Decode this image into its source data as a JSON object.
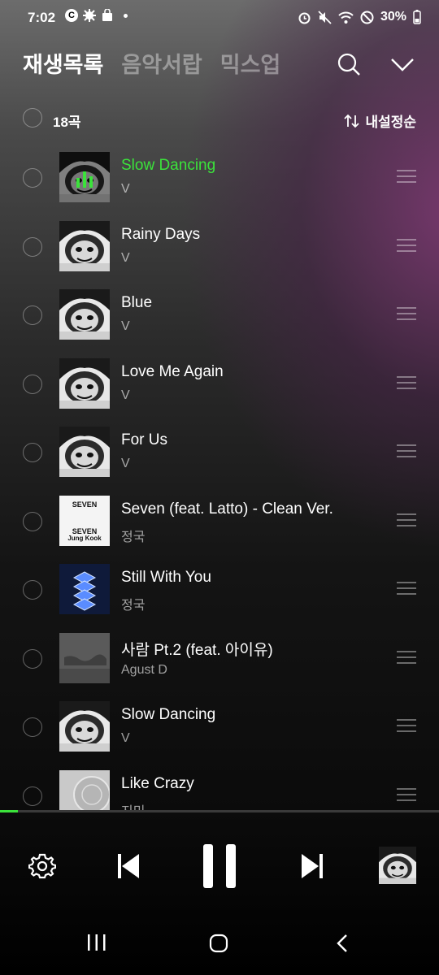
{
  "status": {
    "time": "7:02",
    "battery": "30%"
  },
  "tabs": [
    {
      "label": "재생목록"
    },
    {
      "label": "음악서랍"
    },
    {
      "label": "믹스업"
    }
  ],
  "list_header": {
    "count": "18곡",
    "sort_label": "내설정순"
  },
  "tracks": [
    {
      "title": "Slow Dancing",
      "artist": "V",
      "playing": true,
      "art": "v"
    },
    {
      "title": "Rainy Days",
      "artist": "V",
      "art": "v"
    },
    {
      "title": "Blue",
      "artist": "V",
      "art": "v"
    },
    {
      "title": "Love Me Again",
      "artist": "V",
      "art": "v"
    },
    {
      "title": "For Us",
      "artist": "V",
      "art": "v"
    },
    {
      "title": "Seven (feat. Latto) - Clean Ver.",
      "artist": "정국",
      "art": "seven"
    },
    {
      "title": "Still With You",
      "artist": "정국",
      "art": "still"
    },
    {
      "title": "사람 Pt.2 (feat. 아이유)",
      "artist": "Agust D",
      "art": "agust"
    },
    {
      "title": "Slow Dancing",
      "artist": "V",
      "art": "v"
    },
    {
      "title": "Like Crazy",
      "artist": "지민",
      "art": "jimin"
    }
  ],
  "album_art_text": {
    "seven_title": "SEVEN",
    "seven_artist": "Jung Kook"
  },
  "playback": {
    "progress": 0.04,
    "state": "playing"
  },
  "colors": {
    "accent": "#3be23b"
  }
}
